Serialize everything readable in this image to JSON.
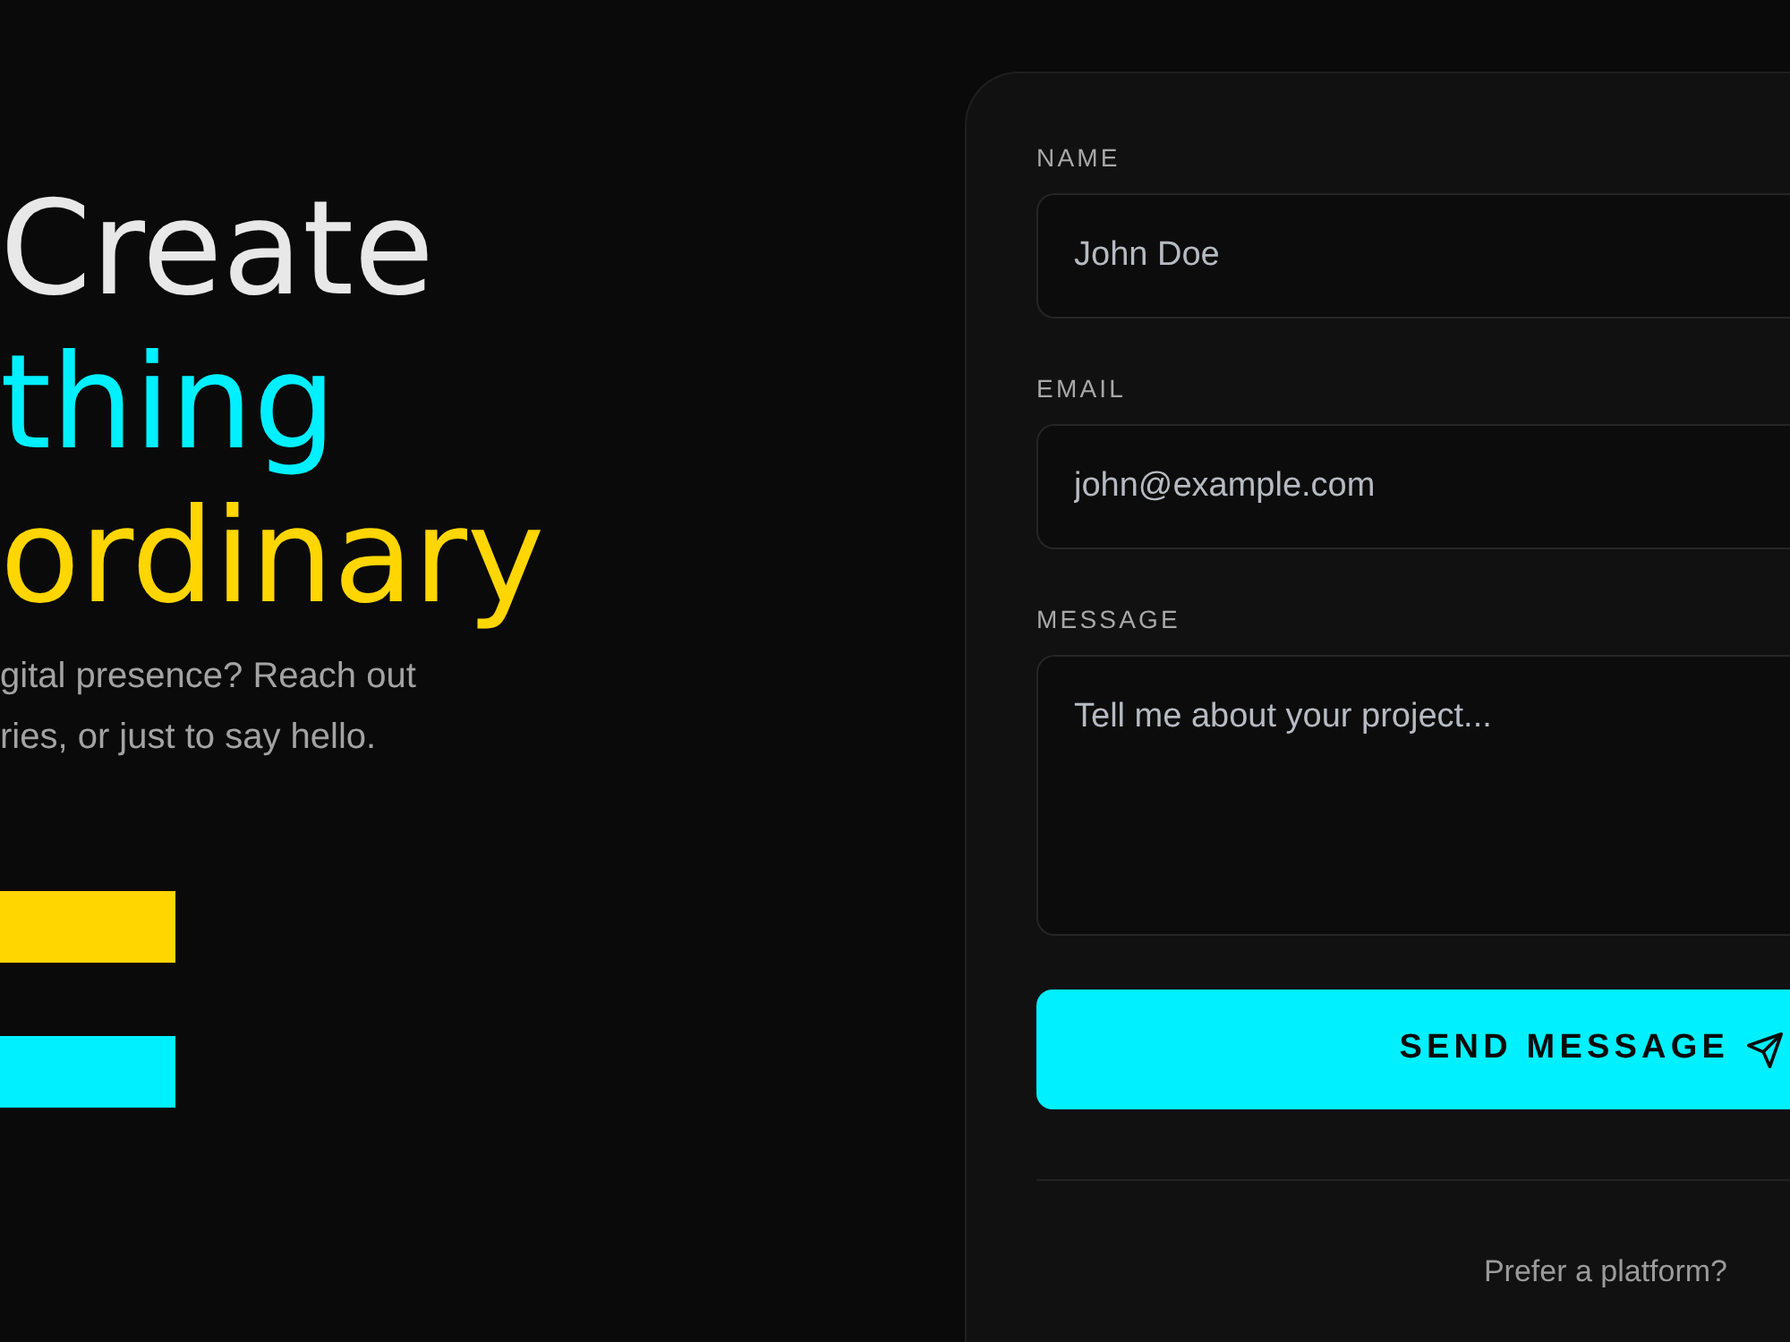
{
  "hero": {
    "heading_lines": [
      {
        "text": "Create",
        "color": "#e8e8e8"
      },
      {
        "text": "thing",
        "color": "#00f0ff"
      },
      {
        "text": "ordinary",
        "color": "#ffd600"
      }
    ],
    "description_lines": [
      "gital presence? Reach out",
      "ries, or just to say hello."
    ],
    "buttons": [
      {
        "color": "#ffd600"
      },
      {
        "color": "#00f0ff"
      }
    ]
  },
  "contact_form": {
    "fields": [
      {
        "kind": "input",
        "label": "NAME",
        "placeholder": "John Doe"
      },
      {
        "kind": "input",
        "label": "EMAIL",
        "placeholder": "john@example.com"
      },
      {
        "kind": "textarea",
        "label": "MESSAGE",
        "placeholder": "Tell me about your project..."
      }
    ],
    "submit": {
      "label": "SEND MESSAGE"
    },
    "footer": {
      "prompt": "Prefer a platform?"
    }
  }
}
